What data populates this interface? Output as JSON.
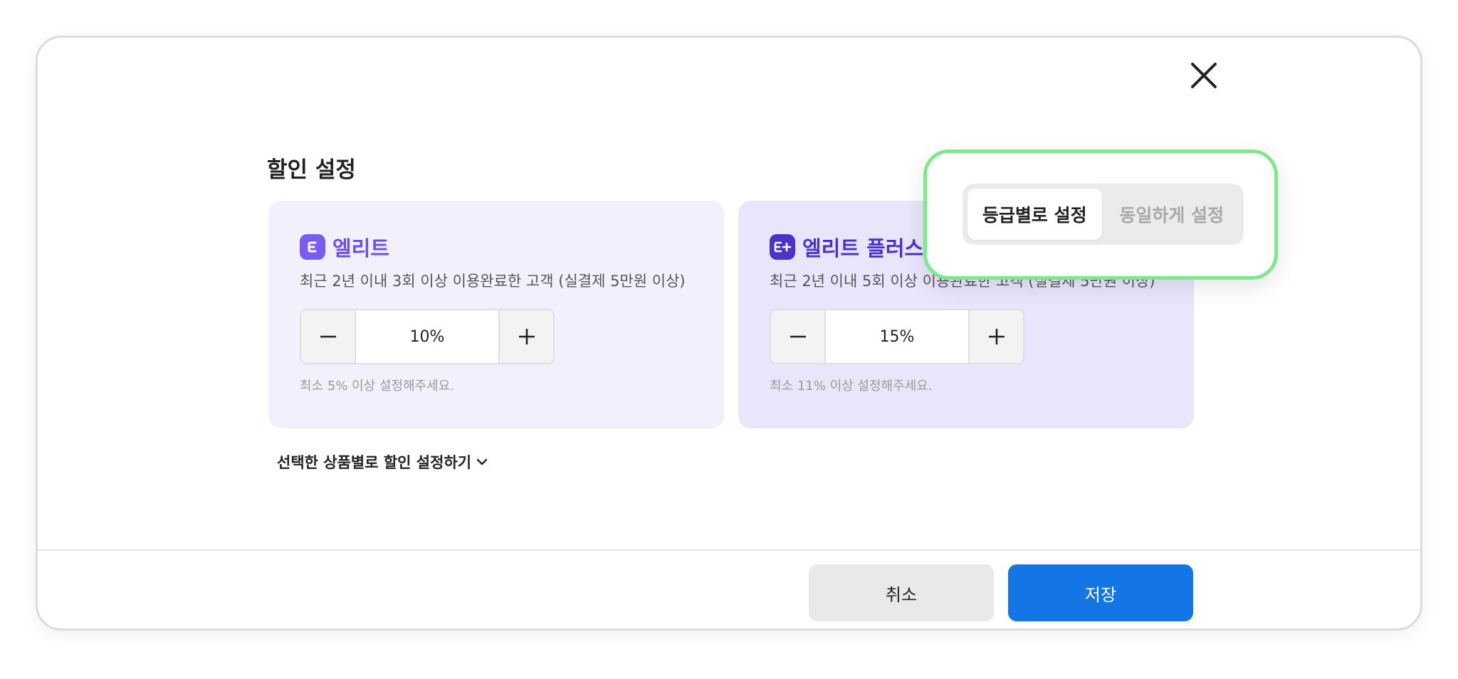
{
  "modal": {
    "title": "할인 설정",
    "grades": [
      {
        "badge": "E",
        "name": "엘리트",
        "description": "최근 2년 이내 3회 이상 이용완료한 고객 (실결제 5만원 이상)",
        "discount": "10%",
        "hint": "최소 5% 이상 설정해주세요."
      },
      {
        "badge": "E+",
        "name": "엘리트 플러스",
        "description": "최근 2년 이내 5회 이상 이용완료한 고객 (실결제 5만원 이상)",
        "discount": "15%",
        "hint": "최소 11% 이상 설정해주세요."
      }
    ],
    "product_toggle": "선택한 상품별로 할인 설정하기",
    "mode": {
      "options": [
        "등급별로 설정",
        "동일하게 설정"
      ],
      "selected": "등급별로 설정"
    },
    "buttons": {
      "cancel": "취소",
      "save": "저장"
    }
  },
  "colors": {
    "accent_blue": "#1476e5",
    "elite_purple": "#6a4ee8",
    "elite_plus_purple": "#4b33c9",
    "highlight_green": "#7fe88a"
  },
  "icons": {
    "close": "close-icon",
    "minus": "minus-icon",
    "plus": "plus-icon",
    "chevron": "chevron-down-icon"
  }
}
